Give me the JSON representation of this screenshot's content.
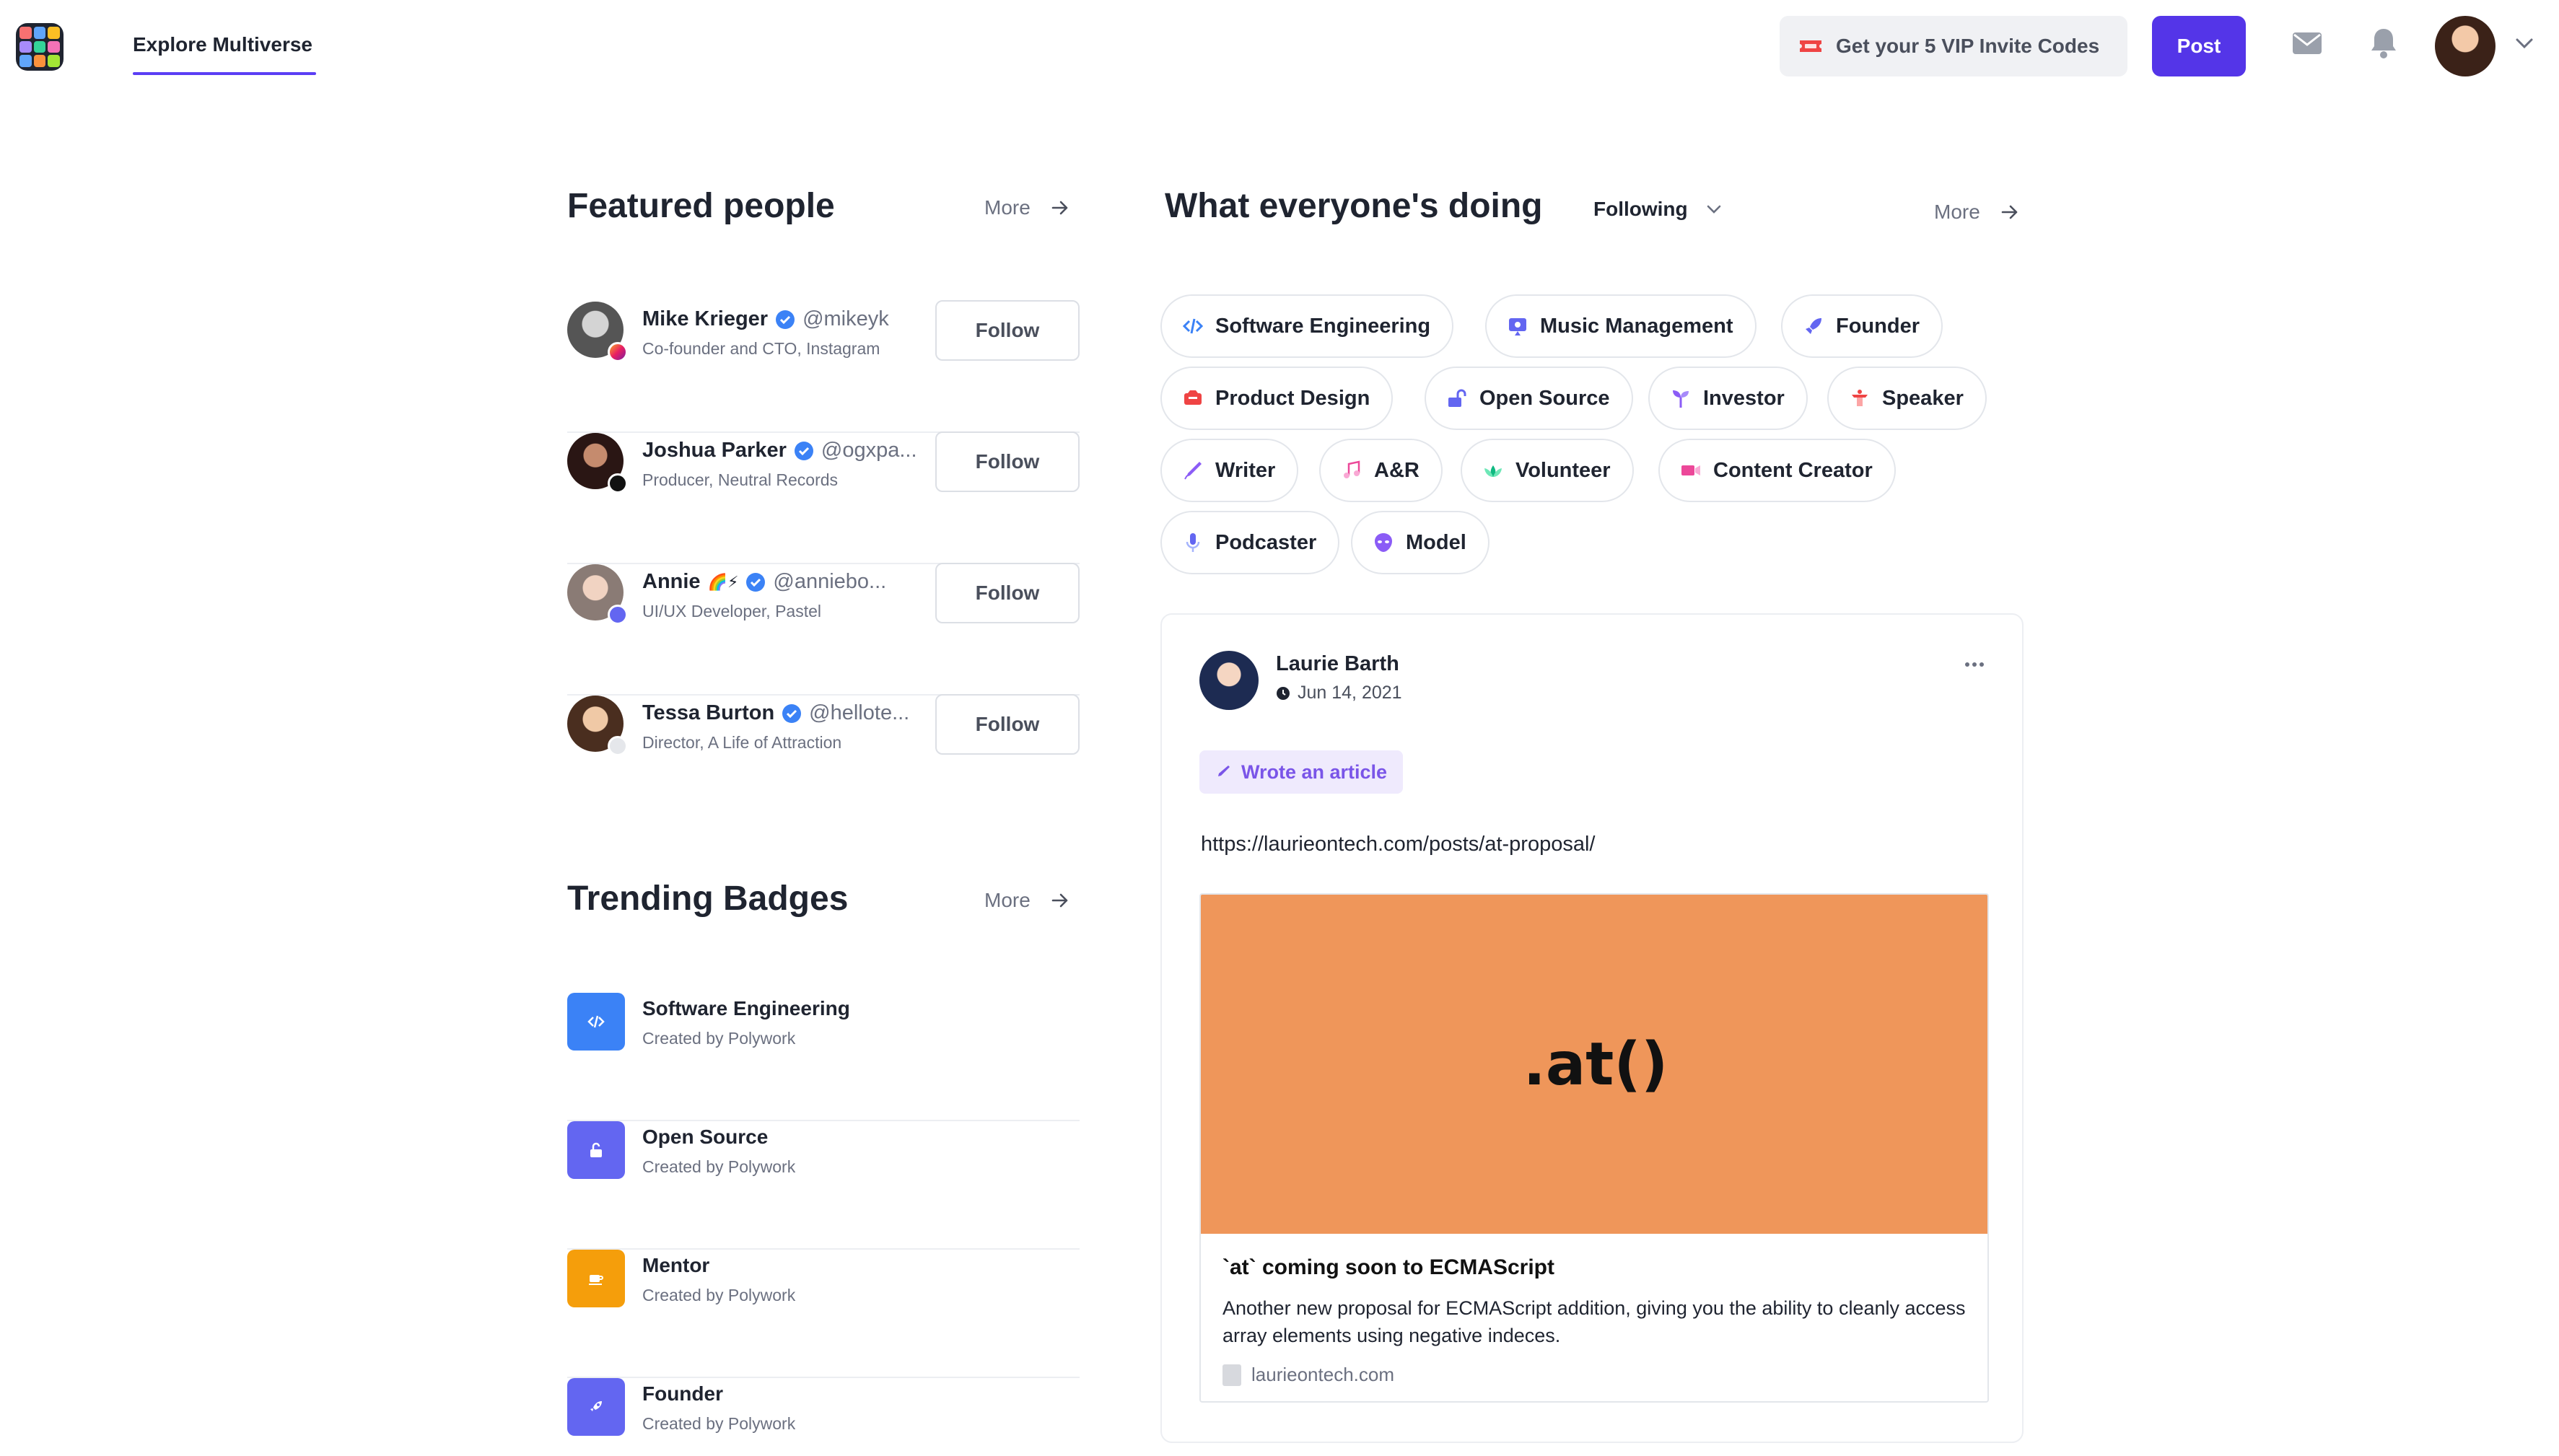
{
  "header": {
    "logo_name": "Polywork",
    "nav_tab": "Explore Multiverse",
    "vip_button": "Get your 5 VIP Invite Codes",
    "post_button": "Post",
    "accent_color": "#5435e8",
    "icons": [
      "ticket-icon",
      "mail-icon",
      "bell-icon",
      "chevron-down-icon"
    ]
  },
  "featured": {
    "title": "Featured people",
    "more": "More",
    "people": [
      {
        "name": "Mike Krieger",
        "handle": "@mikeyk",
        "subtitle": "Co-founder and CTO, Instagram",
        "follow": "Follow"
      },
      {
        "name": "Joshua Parker",
        "handle": "@ogxpa...",
        "subtitle": "Producer, Neutral Records",
        "follow": "Follow"
      },
      {
        "name": "Annie",
        "emoji": "🌈⚡",
        "handle": "@anniebo...",
        "subtitle": "UI/UX Developer, Pastel",
        "follow": "Follow"
      },
      {
        "name": "Tessa Burton",
        "handle": "@hellote...",
        "subtitle": "Director, A Life of Attraction",
        "follow": "Follow"
      }
    ]
  },
  "trending": {
    "title": "Trending Badges",
    "more": "More",
    "badges": [
      {
        "name": "Software Engineering",
        "creator": "Created by Polywork",
        "color": "#3b82f6"
      },
      {
        "name": "Open Source",
        "creator": "Created by Polywork",
        "color": "#6366f1"
      },
      {
        "name": "Mentor",
        "creator": "Created by Polywork",
        "color": "#f59e0b"
      },
      {
        "name": "Founder",
        "creator": "Created by Polywork",
        "color": "#6366f1"
      }
    ]
  },
  "activity": {
    "title": "What everyone's doing",
    "filter": "Following",
    "more": "More",
    "chips": [
      {
        "label": "Software Engineering",
        "icon": "code-icon",
        "color": "#3b82f6"
      },
      {
        "label": "Music Management",
        "icon": "music-management-icon",
        "color": "#6366f1"
      },
      {
        "label": "Founder",
        "icon": "rocket-icon",
        "color": "#6366f1"
      },
      {
        "label": "Product Design",
        "icon": "design-icon",
        "color": "#ef4444"
      },
      {
        "label": "Open Source",
        "icon": "unlock-icon",
        "color": "#6366f1"
      },
      {
        "label": "Investor",
        "icon": "sprout-icon",
        "color": "#8b5cf6"
      },
      {
        "label": "Speaker",
        "icon": "podium-icon",
        "color": "#ef4444"
      },
      {
        "label": "Writer",
        "icon": "pen-icon",
        "color": "#8b5cf6"
      },
      {
        "label": "A&R",
        "icon": "music-note-icon",
        "color": "#ec4899"
      },
      {
        "label": "Volunteer",
        "icon": "lotus-icon",
        "color": "#10b981"
      },
      {
        "label": "Content Creator",
        "icon": "video-icon",
        "color": "#ec4899"
      },
      {
        "label": "Podcaster",
        "icon": "microphone-icon",
        "color": "#6366f1"
      },
      {
        "label": "Model",
        "icon": "alien-icon",
        "color": "#8b5cf6"
      }
    ]
  },
  "post": {
    "author": "Laurie Barth",
    "date": "Jun 14, 2021",
    "activity_label": "Wrote an article",
    "url": "https://laurieontech.com/posts/at-proposal/",
    "preview": {
      "banner_text": ".at()",
      "banner_color": "#ef965a",
      "title": "`at` coming soon to ECMAScript",
      "description": "Another new proposal for ECMAScript addition, giving you the ability to cleanly access array elements using negative indeces.",
      "site": "laurieontech.com"
    }
  }
}
